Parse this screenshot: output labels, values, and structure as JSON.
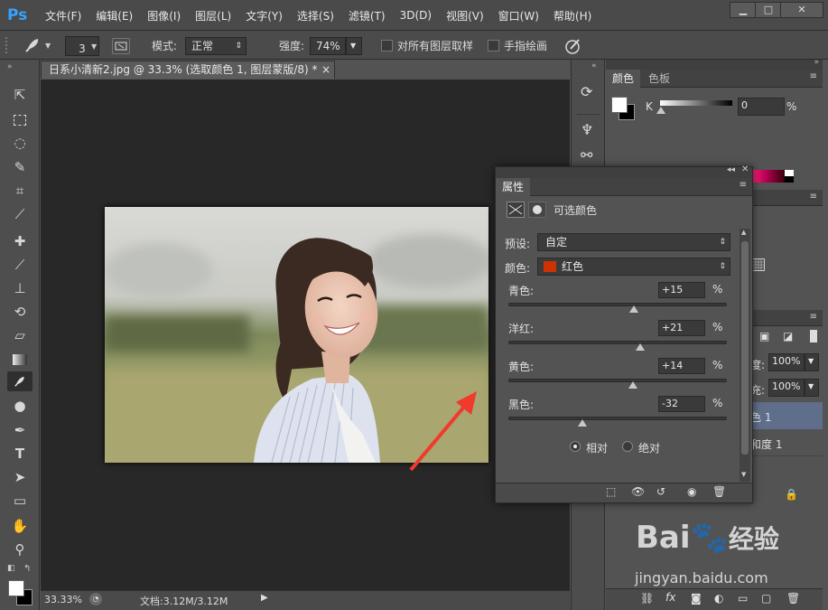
{
  "app": {
    "logo": "Ps"
  },
  "menu": [
    "文件(F)",
    "编辑(E)",
    "图像(I)",
    "图层(L)",
    "文字(Y)",
    "选择(S)",
    "滤镜(T)",
    "3D(D)",
    "视图(V)",
    "窗口(W)",
    "帮助(H)"
  ],
  "window_controls": {
    "minimize": "▁",
    "maximize": "□",
    "close": "✕"
  },
  "options": {
    "brush_size": "3",
    "mode_label": "模式:",
    "mode_value": "正常",
    "strength_label": "强度:",
    "strength_value": "74%",
    "sample_all_layers": "对所有图层取样",
    "finger_paint": "手指绘画"
  },
  "document": {
    "tab_title": "日系小清新2.jpg @ 33.3% (选取颜色 1, 图层蒙版/8) *",
    "tab_close": "×",
    "zoom": "33.33%",
    "doc_info": "文档:3.12M/3.12M"
  },
  "color_panel": {
    "tabs": [
      "颜色",
      "色板"
    ],
    "channel": "K",
    "value": "0",
    "unit": "%",
    "k_level": 0
  },
  "properties": {
    "title": "属性",
    "adjustment_name": "可选颜色",
    "preset_label": "预设:",
    "preset_value": "自定",
    "color_label": "颜色:",
    "color_value": "红色",
    "color_swatch": "#cc3300",
    "sliders": [
      {
        "label": "青色:",
        "value": "+15",
        "unit": "%",
        "level": 0.575
      },
      {
        "label": "洋红:",
        "value": "+21",
        "unit": "%",
        "level": 0.605
      },
      {
        "label": "黄色:",
        "value": "+14",
        "unit": "%",
        "level": 0.57
      },
      {
        "label": "黑色:",
        "value": "-32",
        "unit": "%",
        "level": 0.34
      }
    ],
    "method_relative": "相对",
    "method_absolute": "绝对"
  },
  "layers_partial": {
    "opacity_label": "度:",
    "opacity_value": "100%",
    "fill_label": "充:",
    "fill_value": "100%",
    "layer1": "色 1",
    "layer2": "和度 1"
  },
  "watermark": {
    "brand": "Bai",
    "brand2": "经验",
    "url": "jingyan.baidu.com"
  }
}
